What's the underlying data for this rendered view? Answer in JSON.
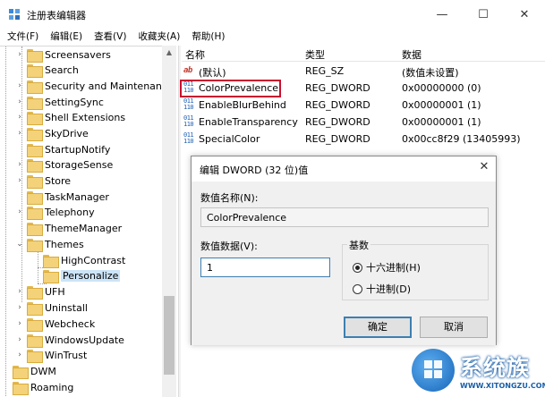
{
  "window": {
    "title": "注册表编辑器",
    "controls": {
      "minimize": "—",
      "maximize": "☐",
      "close": "✕"
    }
  },
  "menu": [
    "文件(F)",
    "编辑(E)",
    "查看(V)",
    "收藏夹(A)",
    "帮助(H)"
  ],
  "tree": {
    "items": [
      {
        "label": "Screensavers",
        "expander": "›"
      },
      {
        "label": "Search",
        "expander": ""
      },
      {
        "label": "Security and Maintenance",
        "expander": "›"
      },
      {
        "label": "SettingSync",
        "expander": "›"
      },
      {
        "label": "Shell Extensions",
        "expander": "›"
      },
      {
        "label": "SkyDrive",
        "expander": "›"
      },
      {
        "label": "StartupNotify",
        "expander": ""
      },
      {
        "label": "StorageSense",
        "expander": "›"
      },
      {
        "label": "Store",
        "expander": "›"
      },
      {
        "label": "TaskManager",
        "expander": ""
      },
      {
        "label": "Telephony",
        "expander": "›"
      },
      {
        "label": "ThemeManager",
        "expander": ""
      },
      {
        "label": "Themes",
        "expander": "⌄"
      },
      {
        "label": "HighContrast",
        "expander": ""
      },
      {
        "label": "Personalize",
        "expander": ""
      },
      {
        "label": "UFH",
        "expander": "›"
      },
      {
        "label": "Uninstall",
        "expander": "›"
      },
      {
        "label": "Webcheck",
        "expander": "›"
      },
      {
        "label": "WindowsUpdate",
        "expander": "›"
      },
      {
        "label": "WinTrust",
        "expander": "›"
      },
      {
        "label": "DWM",
        "expander": ""
      },
      {
        "label": "Roaming",
        "expander": ""
      }
    ],
    "scroll_up": "▲"
  },
  "list": {
    "headers": {
      "name": "名称",
      "type": "类型",
      "data": "数据"
    },
    "rows": [
      {
        "icon": "ab",
        "name": "(默认)",
        "type": "REG_SZ",
        "data": "(数值未设置)"
      },
      {
        "icon": "011 110",
        "name": "ColorPrevalence",
        "type": "REG_DWORD",
        "data": "0x00000000 (0)"
      },
      {
        "icon": "011 110",
        "name": "EnableBlurBehind",
        "type": "REG_DWORD",
        "data": "0x00000001 (1)"
      },
      {
        "icon": "011 110",
        "name": "EnableTransparency",
        "type": "REG_DWORD",
        "data": "0x00000001 (1)"
      },
      {
        "icon": "011 110",
        "name": "SpecialColor",
        "type": "REG_DWORD",
        "data": "0x00cc8f29 (13405993)"
      }
    ]
  },
  "dialog": {
    "title": "编辑 DWORD (32 位)值",
    "close": "✕",
    "name_label": "数值名称(N):",
    "name_value": "ColorPrevalence",
    "data_label": "数值数据(V):",
    "data_value": "1",
    "base_label": "基数",
    "radio_hex": "十六进制(H)",
    "radio_dec": "十进制(D)",
    "ok": "确定",
    "cancel": "取消"
  },
  "watermark": {
    "text": "系统族",
    "url": "WWW.XITONGZU.COM"
  },
  "colors": {
    "highlight_box": "#c8102e",
    "selection": "#cce4f7",
    "accent": "#3c7fb1"
  }
}
